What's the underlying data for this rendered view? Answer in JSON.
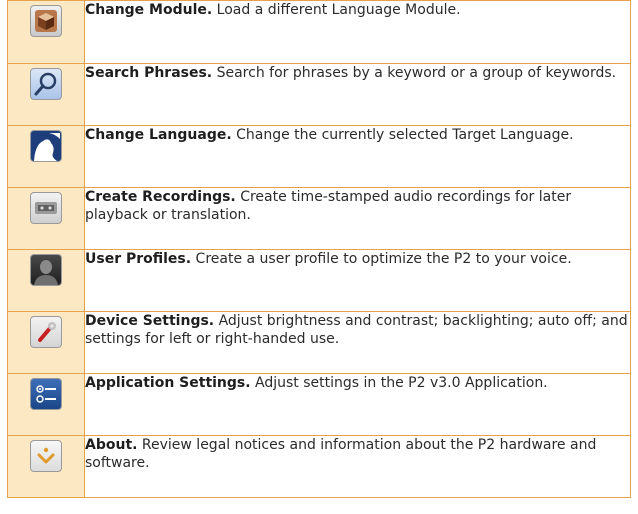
{
  "rows": [
    {
      "title": "Change Module.",
      "text": "Load a different Language Module.",
      "icon": "cube-icon"
    },
    {
      "title": "Search Phrases.",
      "text": "Search for phrases by a keyword or a group of keywords.",
      "icon": "magnifier-icon"
    },
    {
      "title": "Change Language.",
      "text": "Change the currently selected Target Language.",
      "icon": "globe-icon"
    },
    {
      "title": "Create Recordings.",
      "text": "Create time-stamped audio recordings for later playback or translation.",
      "icon": "cassette-icon"
    },
    {
      "title": "User Profiles.",
      "text": "Create a user profile to optimize the P2 to your voice.",
      "icon": "user-silhouette-icon"
    },
    {
      "title": "Device Settings.",
      "text": "Adjust brightness and contrast; backlighting; auto off; and settings for left or right-handed use.",
      "icon": "wrench-icon"
    },
    {
      "title": "Application Settings.",
      "text": "Adjust settings in the P2 v3.0 Application.",
      "icon": "toggle-settings-icon"
    },
    {
      "title": "About.",
      "text": "Review legal notices and information about the P2 hardware and software.",
      "icon": "info-chevron-icon"
    }
  ],
  "colors": {
    "border": "#e6a24b",
    "icon_column": "#fde8c4"
  }
}
